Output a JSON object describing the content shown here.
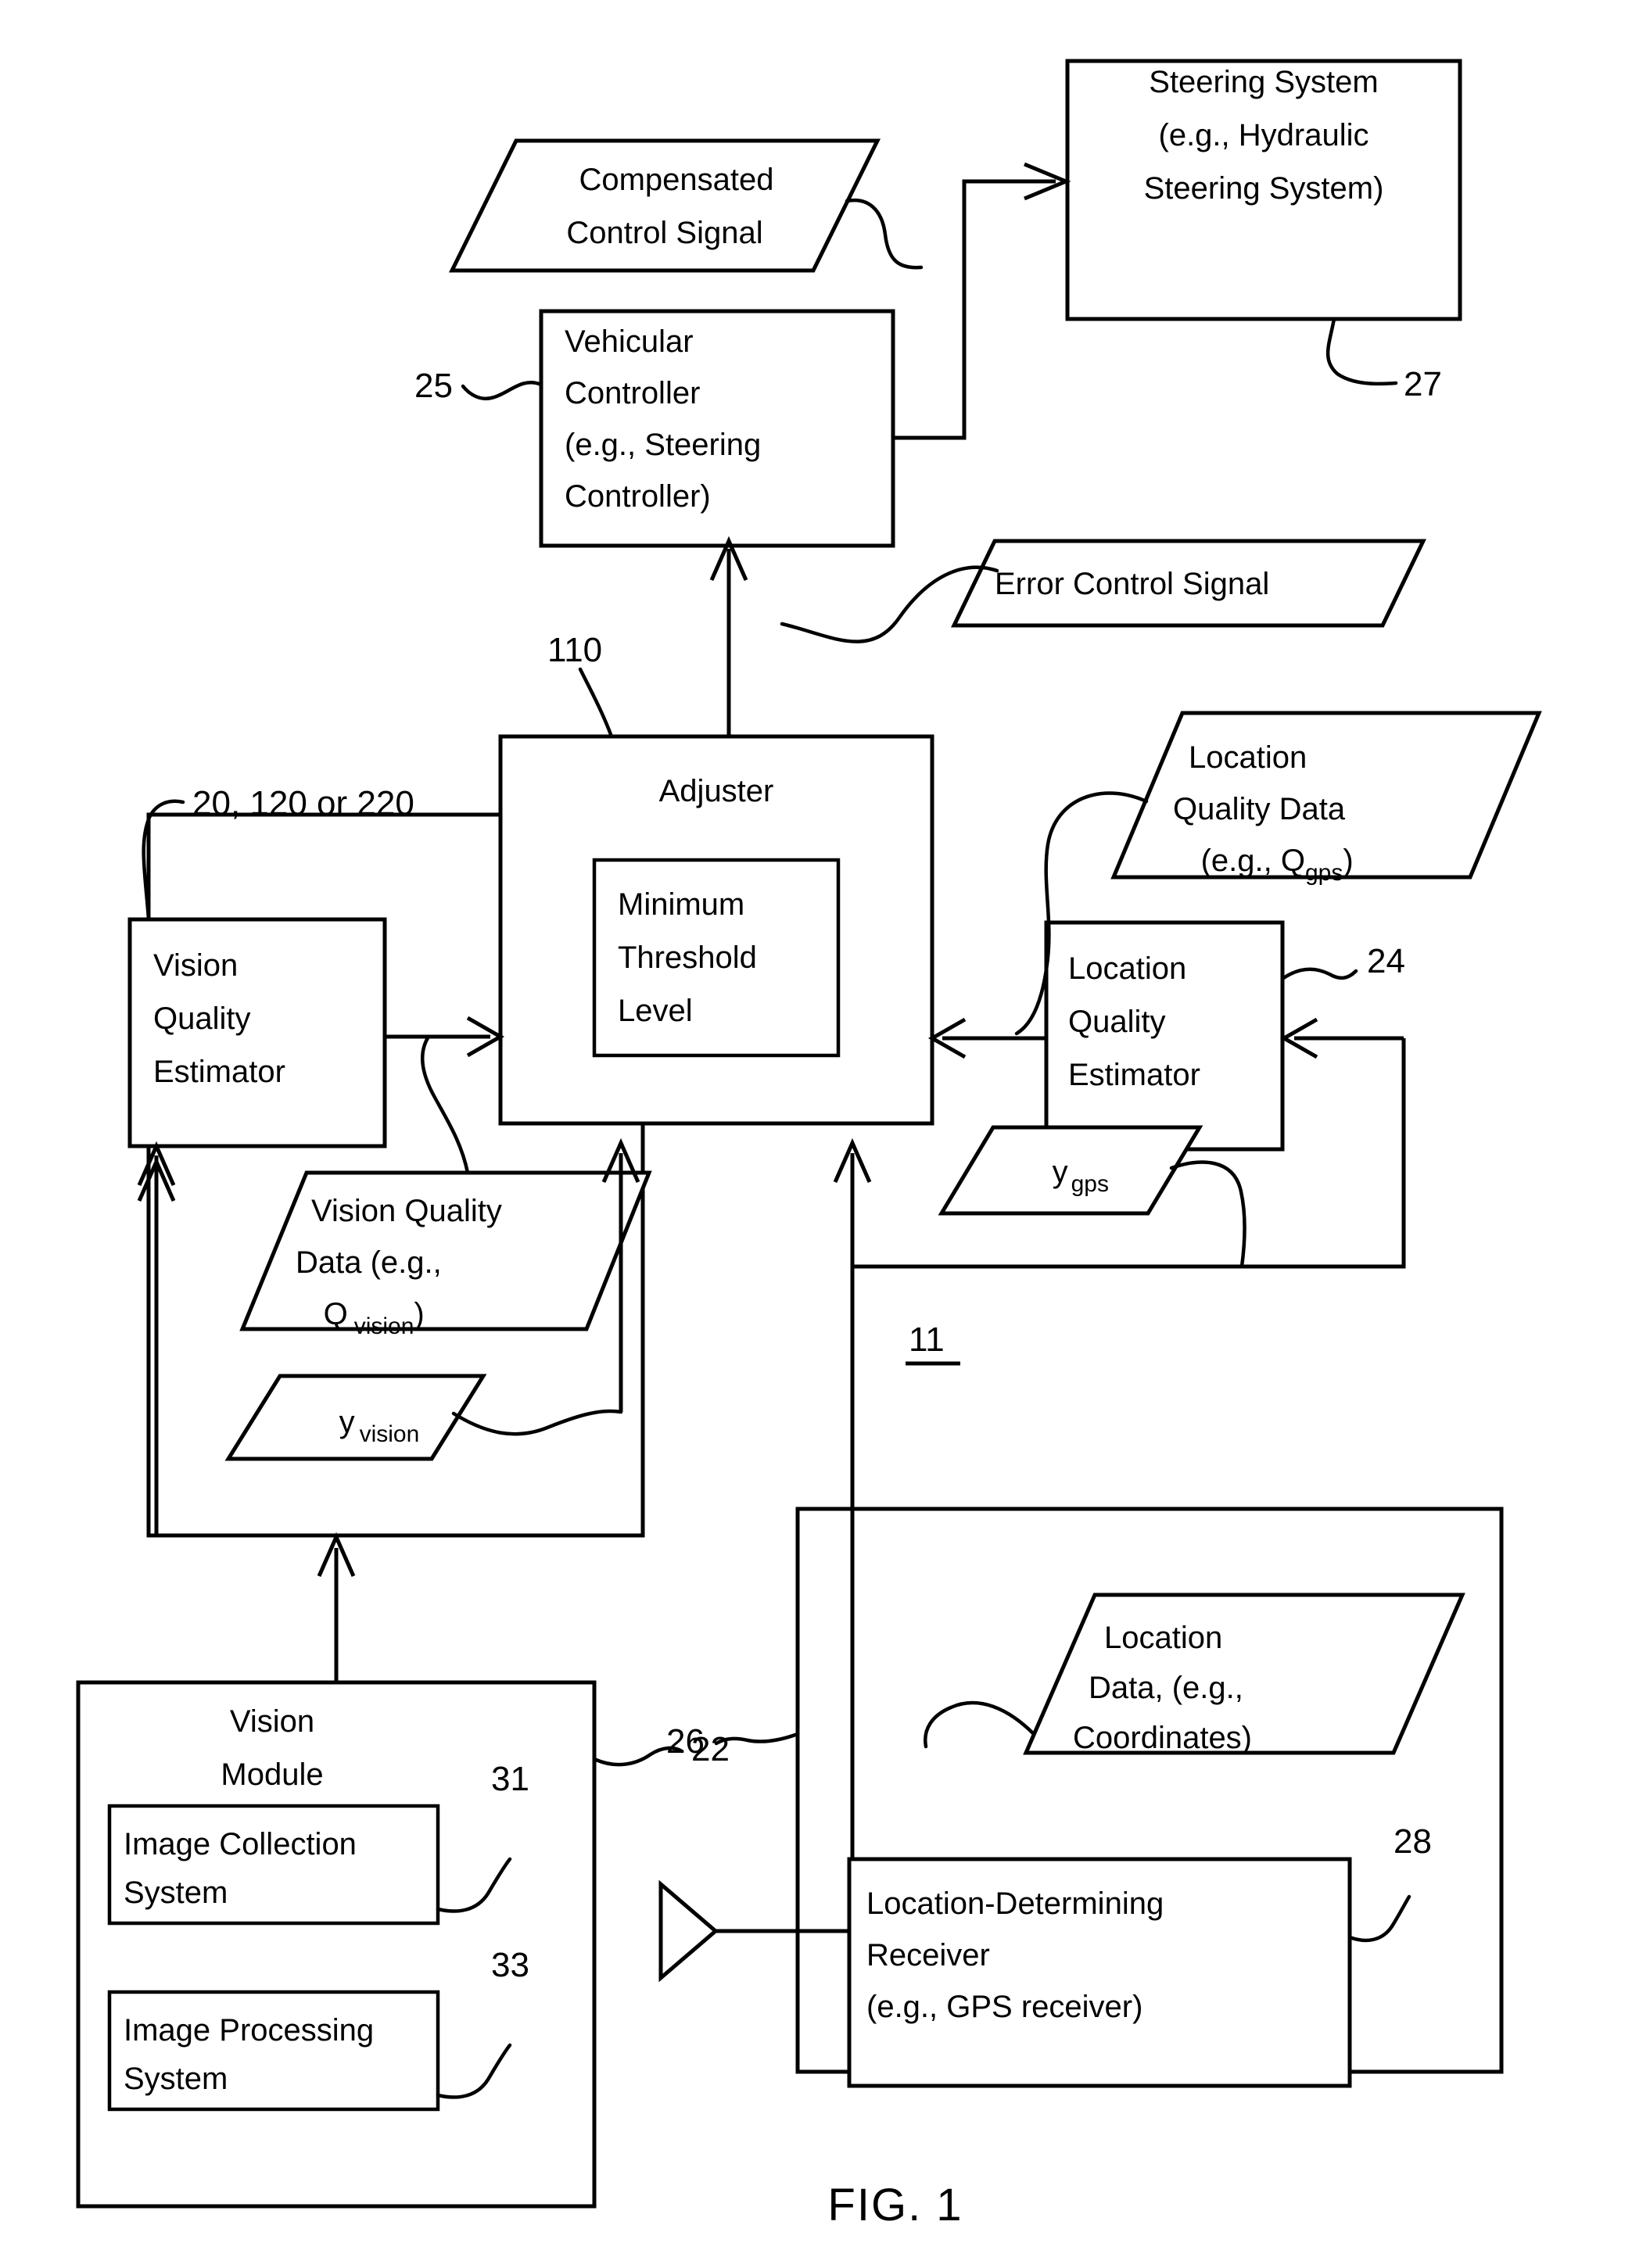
{
  "figure": {
    "caption": "FIG. 1"
  },
  "blocks": {
    "steering_system": {
      "lines": [
        "Steering System",
        "(e.g., Hydraulic",
        "Steering System)"
      ],
      "ref": "27"
    },
    "vehicular_controller": {
      "lines": [
        "Vehicular",
        "Controller",
        "(e.g., Steering",
        "Controller)"
      ],
      "ref": "25"
    },
    "adjuster": {
      "title": "Adjuster",
      "ref": "110"
    },
    "minimum_threshold_level": {
      "lines": [
        "Minimum",
        "Threshold",
        "Level"
      ]
    },
    "vision_quality_estimator": {
      "lines": [
        "Vision",
        "Quality",
        "Estimator"
      ],
      "ref": "20, 120 or 220"
    },
    "location_quality_estimator": {
      "lines": [
        "Location",
        "Quality",
        "Estimator"
      ],
      "ref": "24"
    },
    "vision_module": {
      "lines": [
        "Vision",
        "Module"
      ],
      "ref": "22"
    },
    "image_collection_system": {
      "lines": [
        "Image Collection",
        "System"
      ],
      "ref": "31"
    },
    "image_processing_system": {
      "lines": [
        "Image Processing",
        "System"
      ],
      "ref": "33"
    },
    "location_determining_receiver": {
      "lines": [
        "Location-Determining",
        "Receiver",
        "(e.g., GPS receiver)"
      ],
      "ref": "28"
    },
    "location_container": {
      "ref": "26"
    },
    "system_ref": "11"
  },
  "signals": {
    "compensated_control_signal": {
      "lines": [
        "Compensated",
        "Control Signal"
      ]
    },
    "error_control_signal": {
      "lines": [
        "Error Control Signal"
      ]
    },
    "location_quality_data": {
      "line1": "Location",
      "line2": "Quality Data",
      "line3_prefix": "(e.g., Q",
      "line3_sub": "gps",
      "line3_suffix": ")"
    },
    "vision_quality_data": {
      "line1": "Vision Quality",
      "line2": "Data (e.g.,",
      "line3_prefix": "Q",
      "line3_sub": "vision",
      "line3_suffix": ")"
    },
    "y_vision": {
      "base": "y",
      "sub": "vision"
    },
    "y_gps": {
      "base": "y",
      "sub": "gps"
    },
    "location_data": {
      "lines": [
        "Location",
        "Data, (e.g.,",
        "Coordinates)"
      ]
    }
  },
  "colors": {
    "stroke": "#000000",
    "background": "#ffffff",
    "text": "#000000"
  }
}
